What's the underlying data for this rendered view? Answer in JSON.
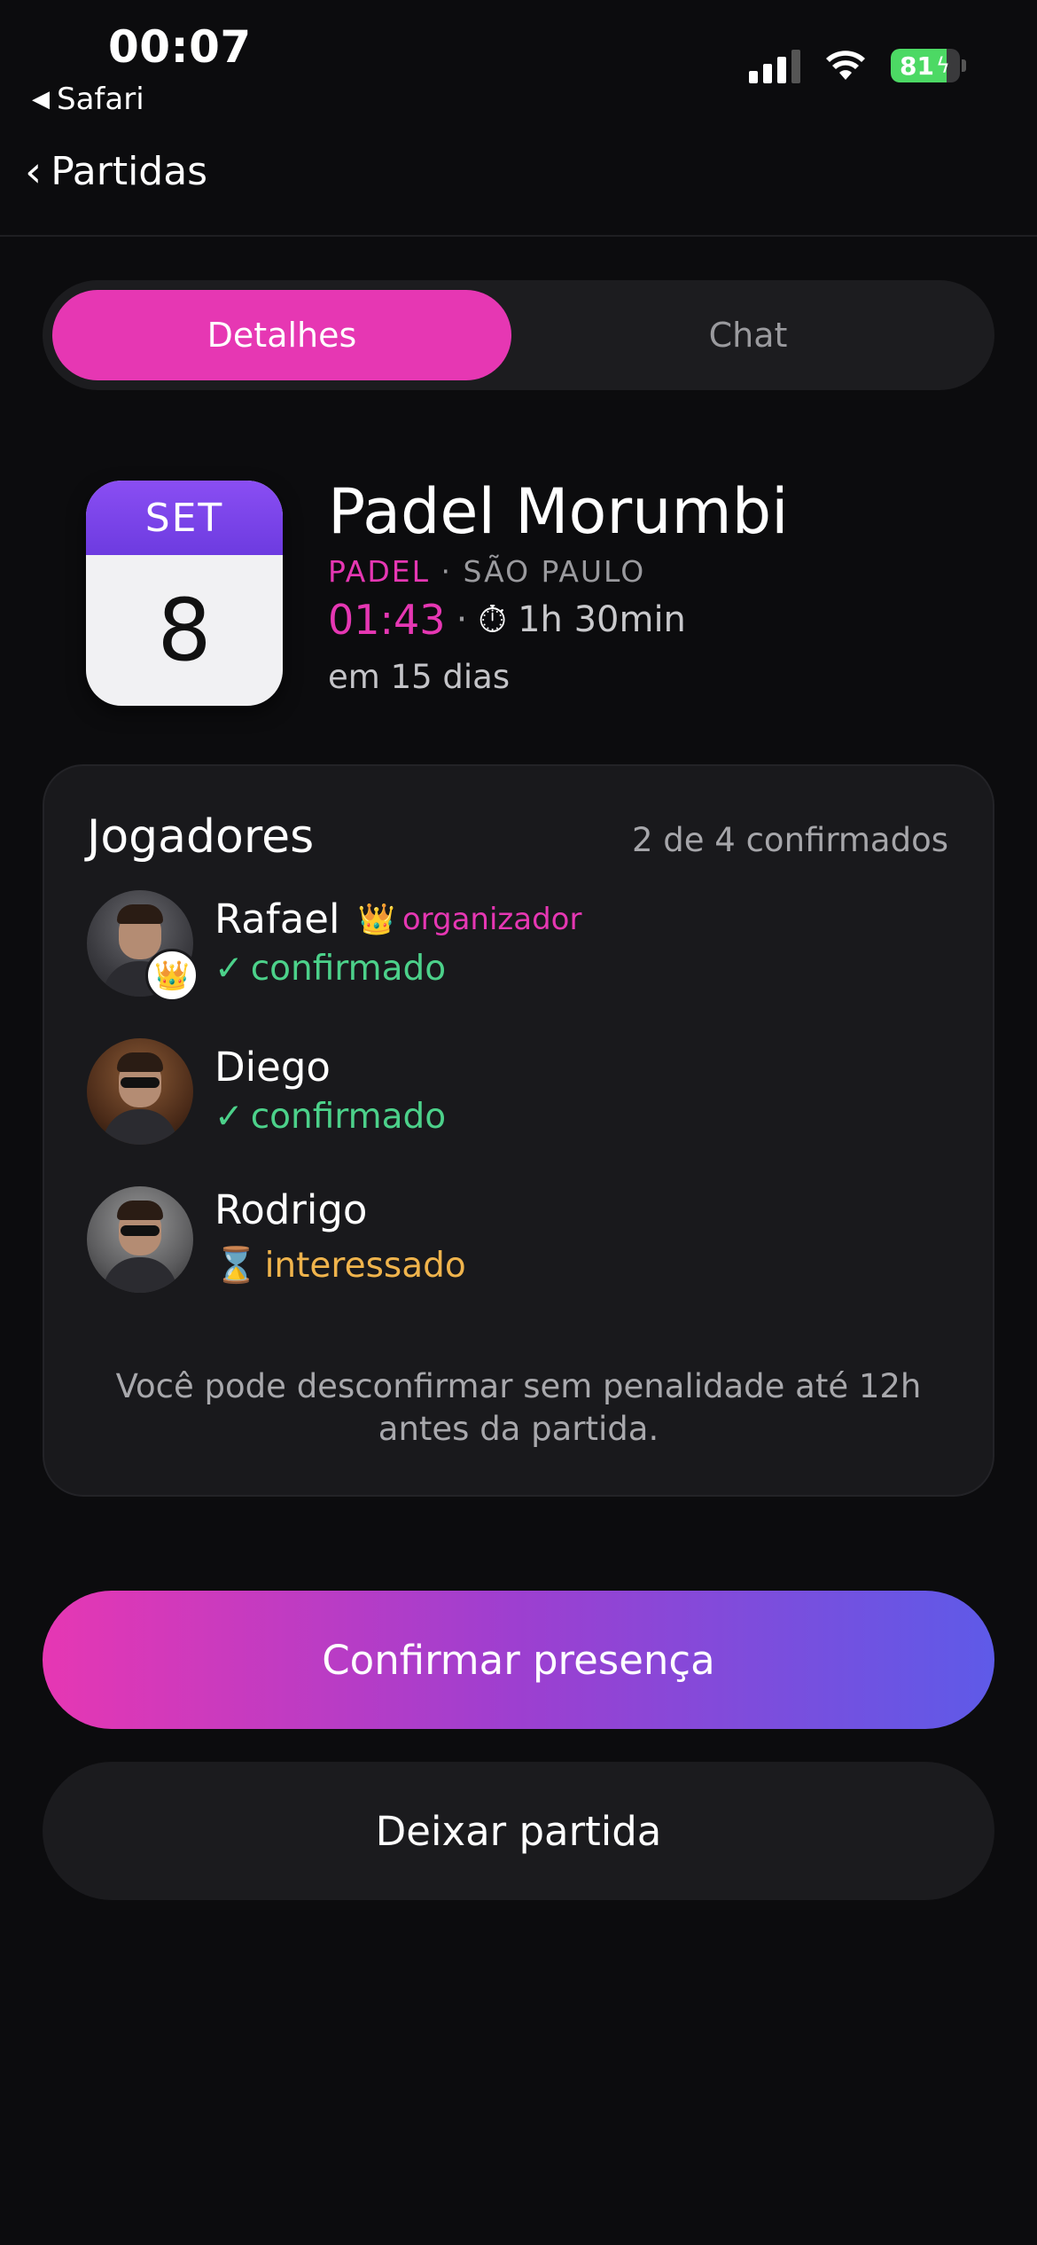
{
  "status_bar": {
    "time": "00:07",
    "back_app": "Safari",
    "battery": "81",
    "battery_level": 0.81
  },
  "nav": {
    "back_label": "Partidas"
  },
  "tabs": [
    {
      "label": "Detalhes",
      "active": true
    },
    {
      "label": "Chat",
      "active": false
    }
  ],
  "match": {
    "calendar_month": "SET",
    "calendar_day": "8",
    "title": "Padel Morumbi",
    "sport": "PADEL",
    "separator": "·",
    "city": "SÃO PAULO",
    "time": "01:43",
    "duration": "1h 30min",
    "when": "em 15 dias"
  },
  "players_card": {
    "title": "Jogadores",
    "count": "2 de 4 confirmados",
    "players": [
      {
        "name": "Rafael",
        "role": "organizador",
        "status_mark": "✓",
        "status": "confirmado"
      },
      {
        "name": "Diego",
        "status_mark": "✓",
        "status": "confirmado"
      },
      {
        "name": "Rodrigo",
        "status_mark": "⌛",
        "status": "interessado"
      }
    ],
    "note": "Você pode desconfirmar sem penalidade até 12h antes da partida."
  },
  "actions": {
    "confirm": "Confirmar presença",
    "leave": "Deixar partida"
  },
  "colors": {
    "accent": "#e637b3",
    "confirmed": "#4cd18a",
    "interested": "#f0b44c",
    "background": "#0c0c0e"
  }
}
